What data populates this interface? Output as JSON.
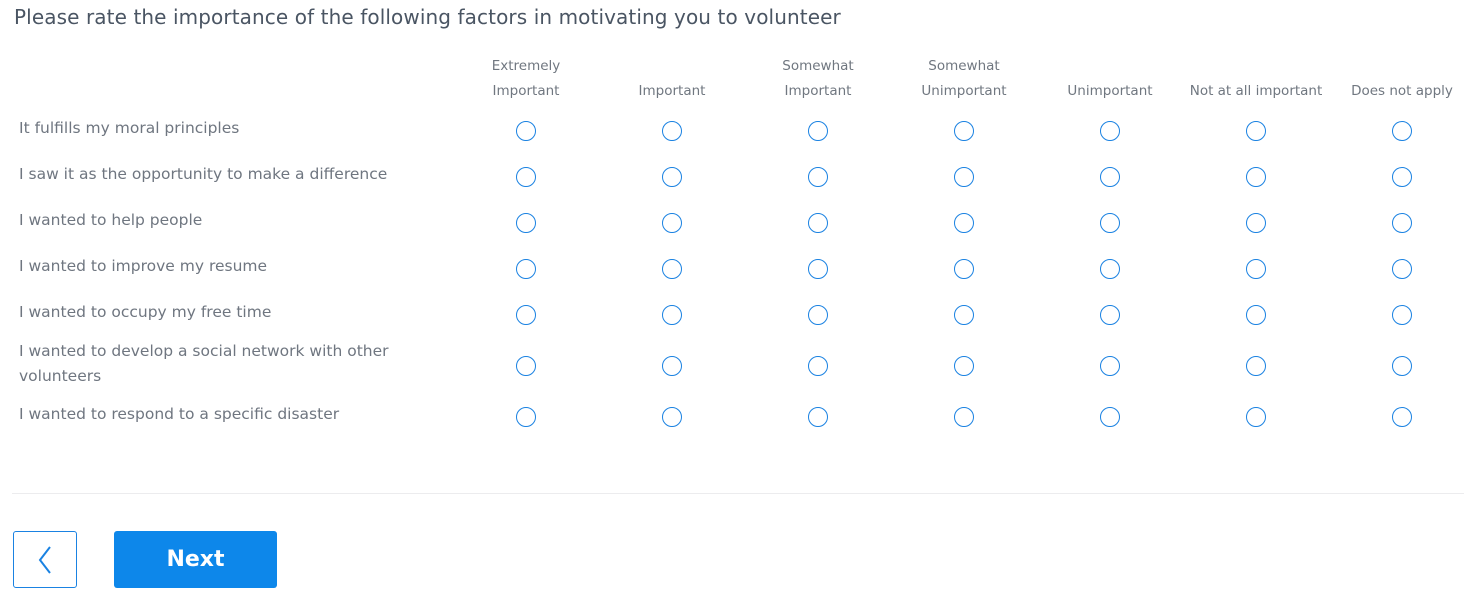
{
  "question": {
    "title": "Please rate the importance of the following factors in motivating you to volunteer"
  },
  "columns": [
    {
      "line1": "Extremely",
      "line2": "Important"
    },
    {
      "line1": "",
      "line2": "Important"
    },
    {
      "line1": "Somewhat",
      "line2": "Important"
    },
    {
      "line1": "Somewhat",
      "line2": "Unimportant"
    },
    {
      "line1": "",
      "line2": "Unimportant"
    },
    {
      "line1": "",
      "line2": "Not at all important"
    },
    {
      "line1": "",
      "line2": "Does not apply"
    }
  ],
  "rows": [
    {
      "label": "It fulfills my moral principles"
    },
    {
      "label": "I saw it as the opportunity to make a difference"
    },
    {
      "label": "I wanted to help people"
    },
    {
      "label": "I wanted to improve my resume"
    },
    {
      "label": "I wanted to occupy my free time"
    },
    {
      "label": "I wanted to develop a social network with other volunteers"
    },
    {
      "label": "I wanted to respond to a specific disaster"
    }
  ],
  "navigation": {
    "back_icon": "chevron-left-icon",
    "next_label": "Next"
  },
  "colors": {
    "accent": "#0d87ea",
    "radio_border": "#1a82e2",
    "text": "#6f7680"
  }
}
